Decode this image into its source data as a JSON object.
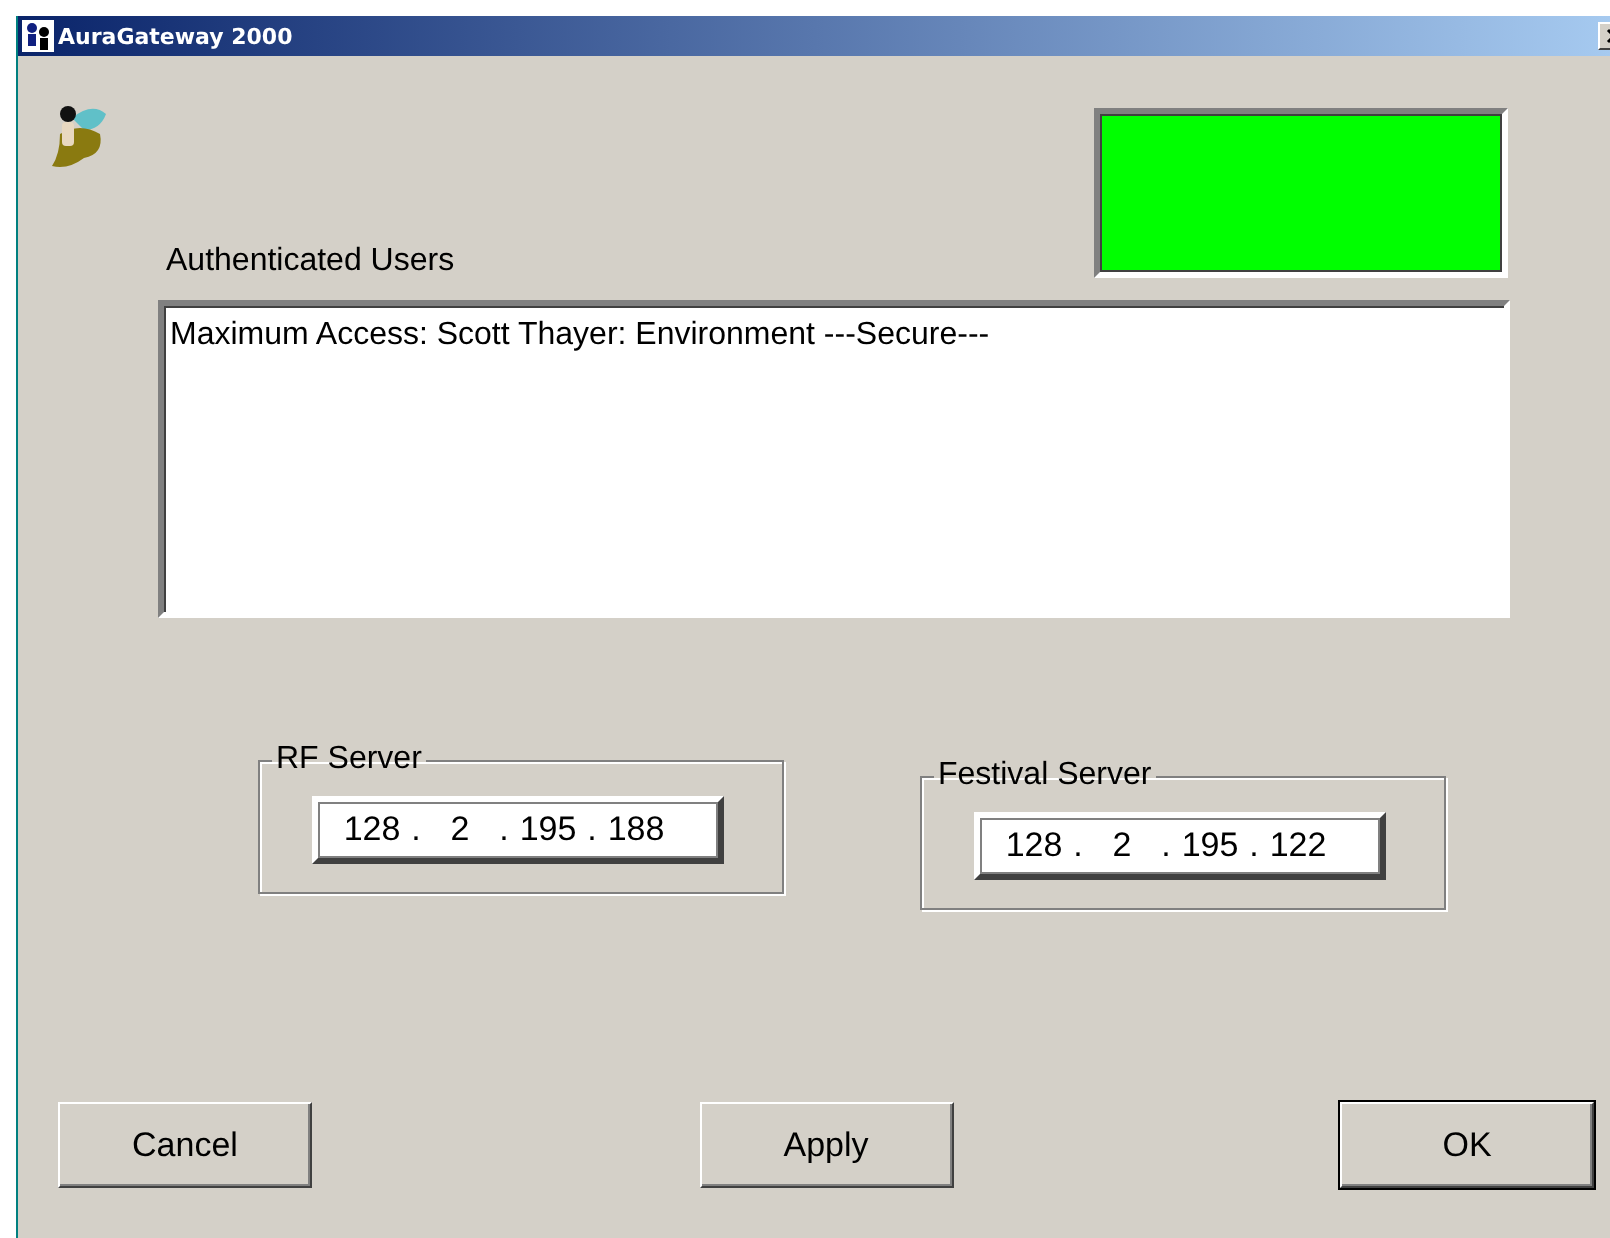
{
  "window": {
    "title": "AuraGateway 2000"
  },
  "status_indicator": {
    "color": "#00ff00"
  },
  "users": {
    "label": "Authenticated Users",
    "items": [
      "Maximum Access: Scott Thayer: Environment ---Secure---"
    ]
  },
  "servers": [
    {
      "label": "RF Server",
      "separator": ".",
      "octets": [
        "128",
        "2",
        "195",
        "188"
      ]
    },
    {
      "label": "Festival Server",
      "separator": ".",
      "octets": [
        "128",
        "2",
        "195",
        "122"
      ]
    }
  ],
  "buttons": [
    "Cancel",
    "Apply",
    "OK"
  ]
}
